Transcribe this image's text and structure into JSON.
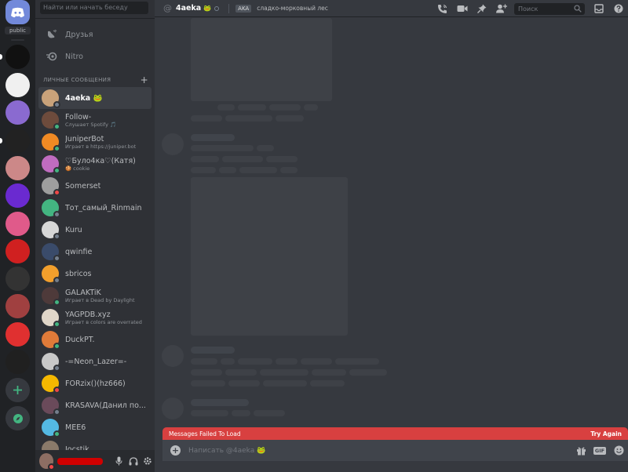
{
  "sidebar": {
    "search_placeholder": "Найти или начать беседу",
    "nav": {
      "friends": "Друзья",
      "nitro": "Nitro"
    },
    "dm_header": "ЛИЧНЫЕ СООБЩЕНИЯ",
    "dms": [
      {
        "name": "4aeka 🐸",
        "sub": "",
        "status": "offline",
        "avatar": "#c9a27a"
      },
      {
        "name": "Follow-",
        "sub": "Слушает Spotify 🎵",
        "status": "online",
        "avatar": "#6d4b3c"
      },
      {
        "name": "JuniperBot",
        "sub": "Играет в https://juniper.bot",
        "status": "online",
        "avatar": "#f08a24"
      },
      {
        "name": "♡Було4ка♡(Катя)",
        "sub": "🍪 cookie",
        "status": "online",
        "avatar": "#c06cc0"
      },
      {
        "name": "Somerset",
        "sub": "",
        "status": "dnd",
        "avatar": "#9e9e9e"
      },
      {
        "name": "Тот_самый_Rinmain",
        "sub": "",
        "status": "offline",
        "avatar": "#43b581"
      },
      {
        "name": "Kuru",
        "sub": "",
        "status": "offline",
        "avatar": "#d7d7d7"
      },
      {
        "name": "qwinfie",
        "sub": "",
        "status": "offline",
        "avatar": "#3a4b6a"
      },
      {
        "name": "sbricos",
        "sub": "",
        "status": "offline",
        "avatar": "#f29f2c"
      },
      {
        "name": "GALAKTiK",
        "sub": "Играет в Dead by Daylight",
        "status": "online",
        "avatar": "#4e3a3a"
      },
      {
        "name": "YAGPDB.xyz",
        "sub": "Играет в colors are overrated",
        "status": "online",
        "avatar": "#e0d6c8"
      },
      {
        "name": "DuckPT.",
        "sub": "",
        "status": "online",
        "avatar": "#e07b39"
      },
      {
        "name": "-=Neon_Lazer=-",
        "sub": "",
        "status": "offline",
        "avatar": "#c8c8c8"
      },
      {
        "name": "FORzix()(hz666)",
        "sub": "",
        "status": "dnd",
        "avatar": "#f5b800"
      },
      {
        "name": "KRASAVA(Данил по...",
        "sub": "",
        "status": "offline",
        "avatar": "#6a4a5a"
      },
      {
        "name": "MEE6",
        "sub": "",
        "status": "online",
        "avatar": "#54b9e3"
      },
      {
        "name": "Jocstik",
        "sub": "",
        "status": "offline",
        "avatar": "#8a7a6a"
      }
    ]
  },
  "rail": {
    "public_label": "public",
    "servers": [
      "#111111",
      "#f0f0f0",
      "#8a6ad0",
      "#222222",
      "#c88",
      "#6a2ad0",
      "#e05a8a",
      "#d02020",
      "#333333",
      "#a04040",
      "#e03030",
      "#202020"
    ]
  },
  "header": {
    "name": "4aeka",
    "emoji": "🐸",
    "aka_label": "AKA",
    "nickname": "сладко-морковный лес",
    "search_placeholder": "Поиск"
  },
  "error": {
    "message": "Messages Failed To Load",
    "retry": "Try Again"
  },
  "composer": {
    "placeholder": "Написать @4aeka 🐸",
    "gif_label": "GIF"
  },
  "colors": {
    "blurple": "#7289da",
    "online": "#43b581",
    "dnd": "#f04747",
    "offline": "#747f8d",
    "error": "#d84040"
  }
}
